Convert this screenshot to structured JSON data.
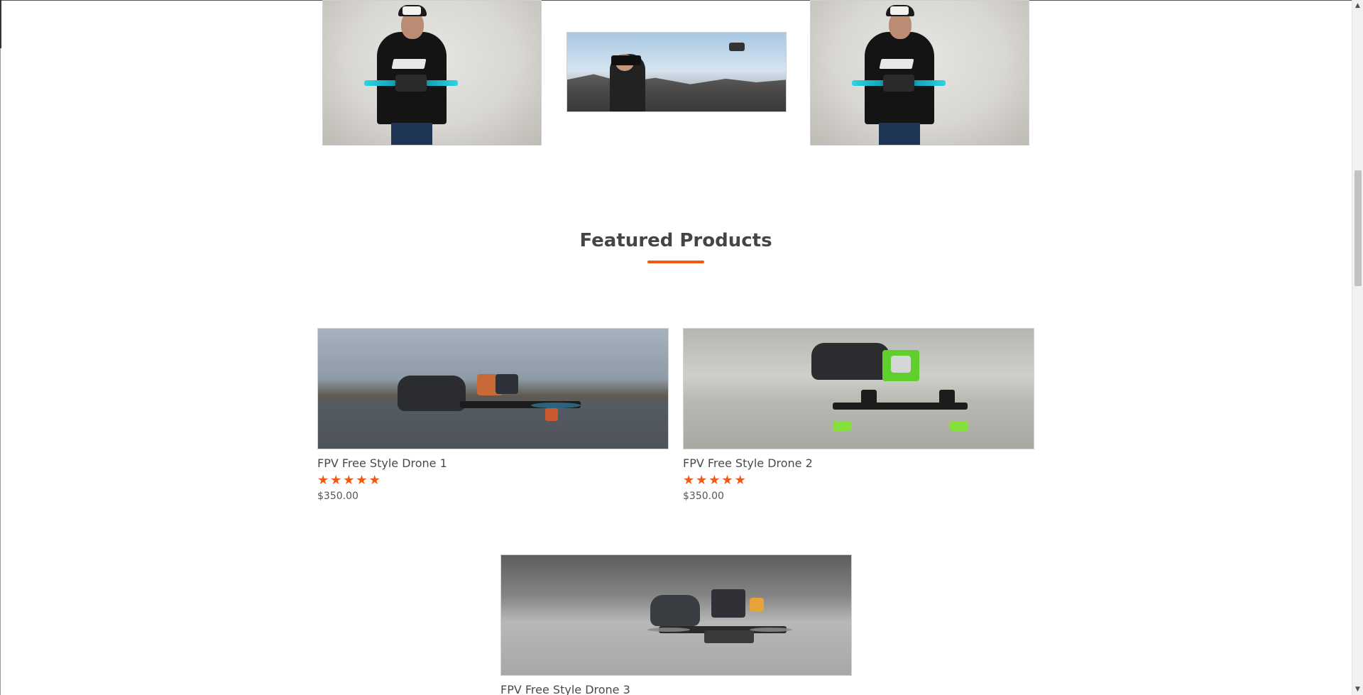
{
  "section": {
    "title": "Featured Products"
  },
  "products": [
    {
      "name": "FPV Free Style Drone 1",
      "price": "$350.00",
      "rating": 5
    },
    {
      "name": "FPV Free Style Drone 2",
      "price": "$350.00",
      "rating": 5
    },
    {
      "name": "FPV Free Style Drone 3"
    }
  ],
  "scrollbar": {
    "up_arrow": "▲",
    "down_arrow": "▼"
  },
  "colors": {
    "accent": "#f15a12",
    "text": "#454545"
  }
}
